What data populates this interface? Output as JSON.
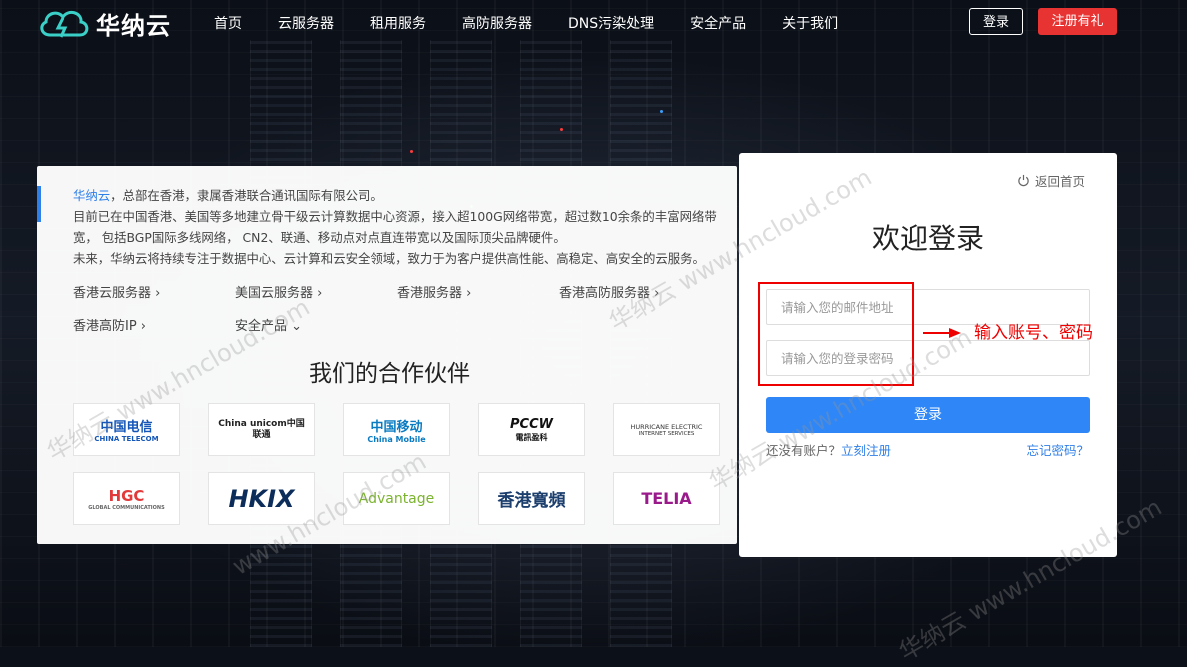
{
  "header": {
    "logo_text": "华纳云",
    "nav": [
      "首页",
      "云服务器",
      "租用服务",
      "高防服务器",
      "DNS污染处理",
      "安全产品",
      "关于我们"
    ],
    "login_label": "登录",
    "register_label": "注册有礼"
  },
  "intro": {
    "brand": "华纳云",
    "line1_rest": "，总部在香港，隶属香港联合通讯国际有限公司。",
    "line2": "目前已在中国香港、美国等多地建立骨干级云计算数据中心资源，接入超100G网络带宽，超过数10余条的丰富网络带宽， 包括BGP国际多线网络， CN2、联通、移动点对点直连带宽以及国际顶尖品牌硬件。",
    "line3": "未来，华纳云将持续专注于数据中心、云计算和云安全领域，致力于为客户提供高性能、高稳定、高安全的云服务。"
  },
  "links": [
    "香港云服务器 ›",
    "美国云服务器 ›",
    "香港服务器 ›",
    "香港高防服务器 ›",
    "香港高防IP ›",
    "安全产品 ⌄"
  ],
  "partners": {
    "title": "我们的合作伙伴",
    "items": [
      {
        "name": "中国电信",
        "sub": "CHINA TELECOM"
      },
      {
        "name": "China unicom中国联通",
        "sub": ""
      },
      {
        "name": "中国移动",
        "sub": "China Mobile"
      },
      {
        "name": "PCCW",
        "sub": "電訊盈科"
      },
      {
        "name": "HURRICANE ELECTRIC",
        "sub": "INTERNET SERVICES"
      },
      {
        "name": "HGC",
        "sub": "GLOBAL COMMUNICATIONS"
      },
      {
        "name": "HKIX",
        "sub": ""
      },
      {
        "name": "Advantage",
        "sub": ""
      },
      {
        "name": "香港寬頻",
        "sub": ""
      },
      {
        "name": "TELIA",
        "sub": ""
      }
    ]
  },
  "login": {
    "back_home": "返回首页",
    "title": "欢迎登录",
    "email_placeholder": "请输入您的邮件地址",
    "password_placeholder": "请输入您的登录密码",
    "submit": "登录",
    "no_account": "还没有账户？",
    "register_now": "立刻注册",
    "forgot": "忘记密码？"
  },
  "annotation": "输入账号、密码",
  "watermark": [
    "华纳云 www.hncloud.com",
    "华纳云 www.hncloud.com",
    "华纳云 www.hncloud.com",
    "www.hncloud.com",
    "华纳云 www.hncloud.com"
  ],
  "colors": {
    "accent": "#2f86f6",
    "register": "#e83333",
    "annotation": "#e00000"
  }
}
